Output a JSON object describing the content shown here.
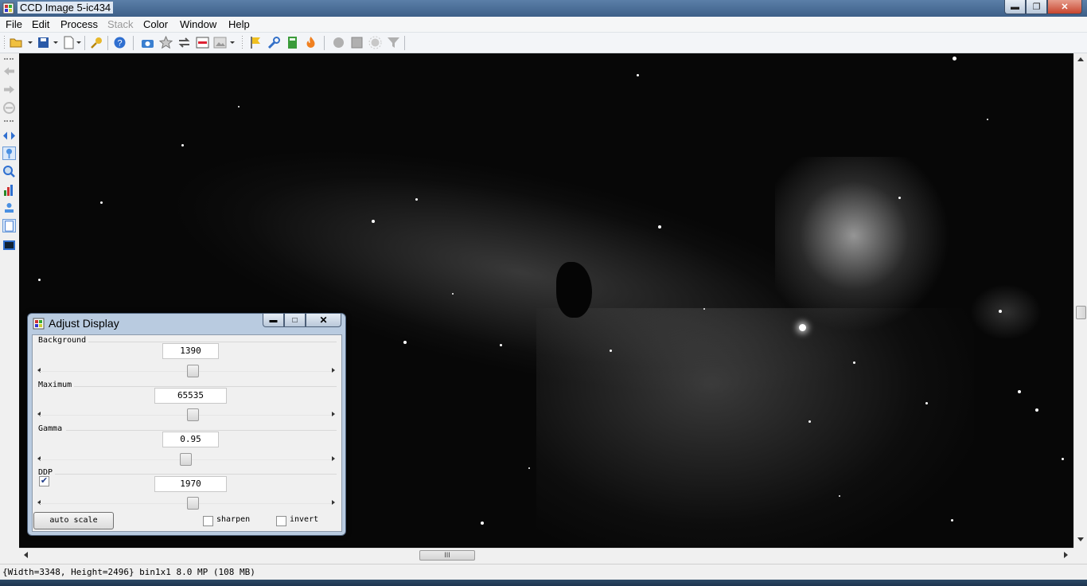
{
  "window": {
    "title": "CCD Image 5-ic434"
  },
  "menu": [
    "File",
    "Edit",
    "Process",
    "Stack",
    "Color",
    "Window",
    "Help"
  ],
  "toolbar_icons": [
    "open-folder-icon",
    "save-icon",
    "new-document-icon",
    "key-icon",
    "help-icon",
    "camera-icon",
    "star-icon",
    "refresh-icon",
    "window-icon",
    "image-icon",
    "flag-icon",
    "wrench-icon",
    "calculator-icon",
    "flame-icon",
    "circle-icon",
    "square-icon",
    "sun-icon",
    "funnel-icon"
  ],
  "sidebar_icons": [
    "back-arrow-icon",
    "forward-arrow-icon",
    "cancel-icon",
    "pan-icon",
    "pointer-icon",
    "zoom-icon",
    "histogram-icon",
    "stamp-icon",
    "clipboard-icon",
    "image-view-icon"
  ],
  "dialog": {
    "title": "Adjust Display",
    "background": {
      "label": "Background",
      "value": "1390",
      "slider": 0.5
    },
    "maximum": {
      "label": "Maximum",
      "value": "65535",
      "slider": 0.5
    },
    "gamma": {
      "label": "Gamma",
      "value": "0.95",
      "slider": 0.47
    },
    "ddp": {
      "label": "DDP",
      "checked": true,
      "value": "1970",
      "slider": 0.5
    },
    "auto_scale": "auto scale",
    "sharpen": {
      "label": "sharpen",
      "checked": false
    },
    "invert": {
      "label": "invert",
      "checked": false
    },
    "close_glyph": "✕"
  },
  "h_scroll_grip": "III",
  "status": "{Width=3348, Height=2496} bin1x1  8.0 MP (108 MB)",
  "colors": {
    "titlebar": "#4d6f97",
    "image_bg": "#070707",
    "dialog_frame": "#b9cbe0"
  }
}
